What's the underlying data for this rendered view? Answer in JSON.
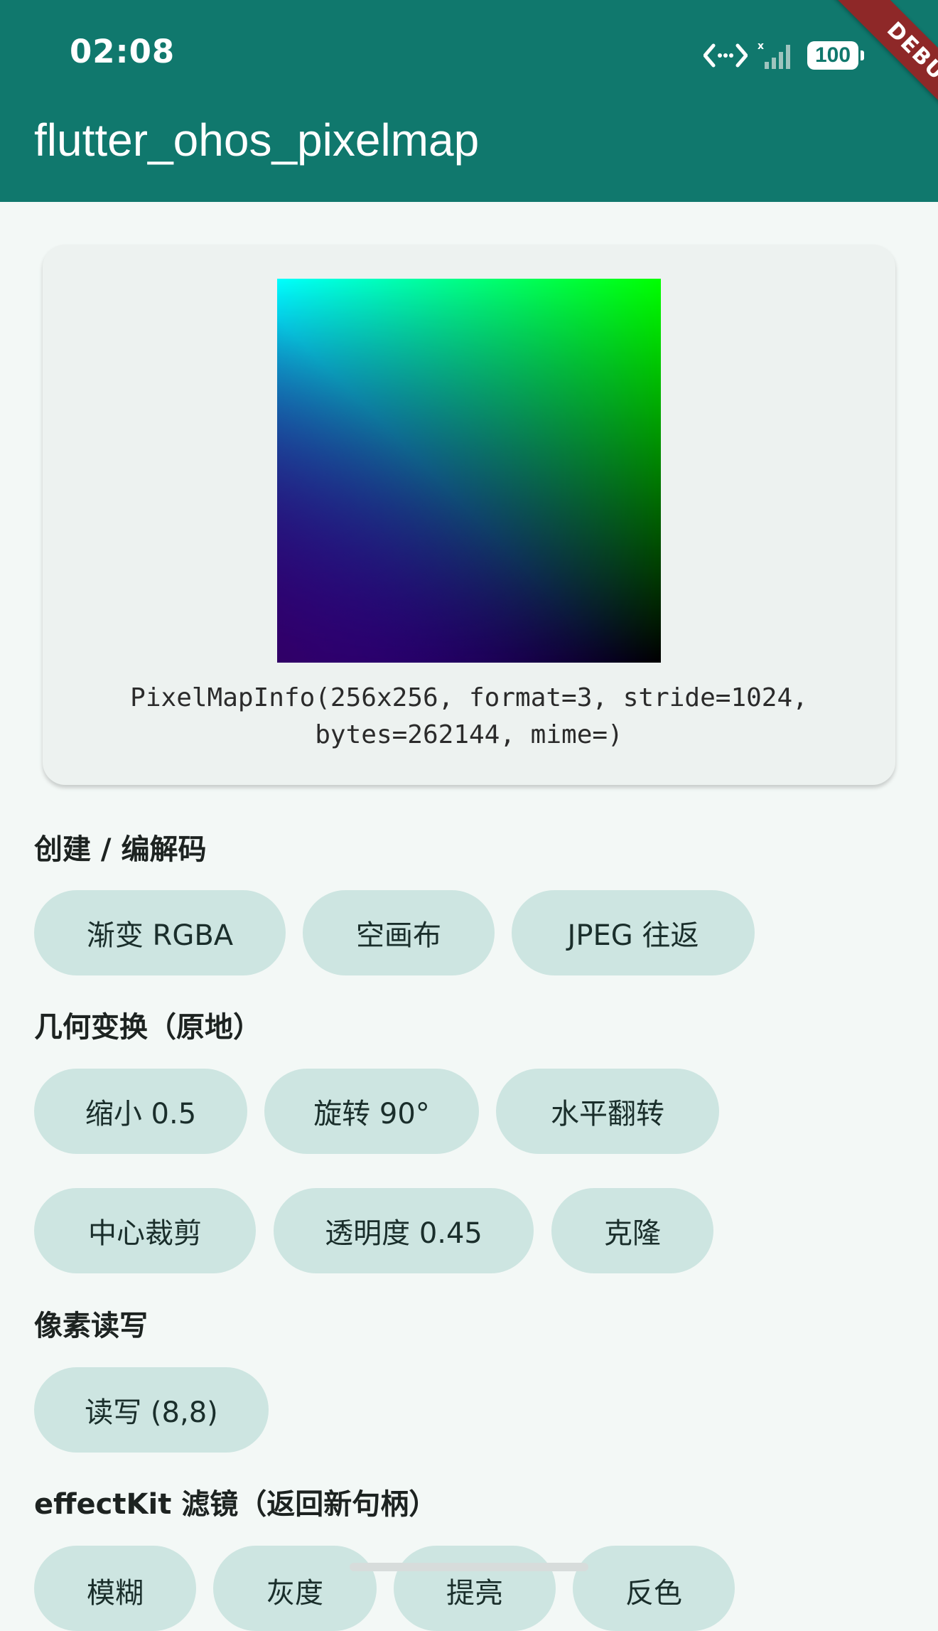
{
  "status_bar": {
    "time": "02:08",
    "battery": "100"
  },
  "app_bar": {
    "title": "flutter_ohos_pixelmap",
    "debug_banner": "DEBUG"
  },
  "info": {
    "line1": "PixelMapInfo(256x256, format=3, stride=1024,",
    "line2": "bytes=262144, mime=)"
  },
  "sections": {
    "create": {
      "title": "创建 / 编解码",
      "buttons": [
        "渐变 RGBA",
        "空画布",
        "JPEG 往返"
      ]
    },
    "geometry": {
      "title": "几何变换（原地）",
      "buttons": [
        "缩小 0.5",
        "旋转 90°",
        "水平翻转",
        "中心裁剪",
        "透明度 0.45",
        "克隆"
      ]
    },
    "pixels": {
      "title": "像素读写",
      "buttons": [
        "读写 (8,8)"
      ]
    },
    "effects": {
      "title": "effectKit 滤镜（返回新句柄）",
      "buttons": [
        "模糊",
        "灰度",
        "提亮",
        "反色"
      ]
    }
  },
  "colors": {
    "app_bar": "#10786d",
    "button": "#cde5e1",
    "background": "#f3f8f6"
  }
}
